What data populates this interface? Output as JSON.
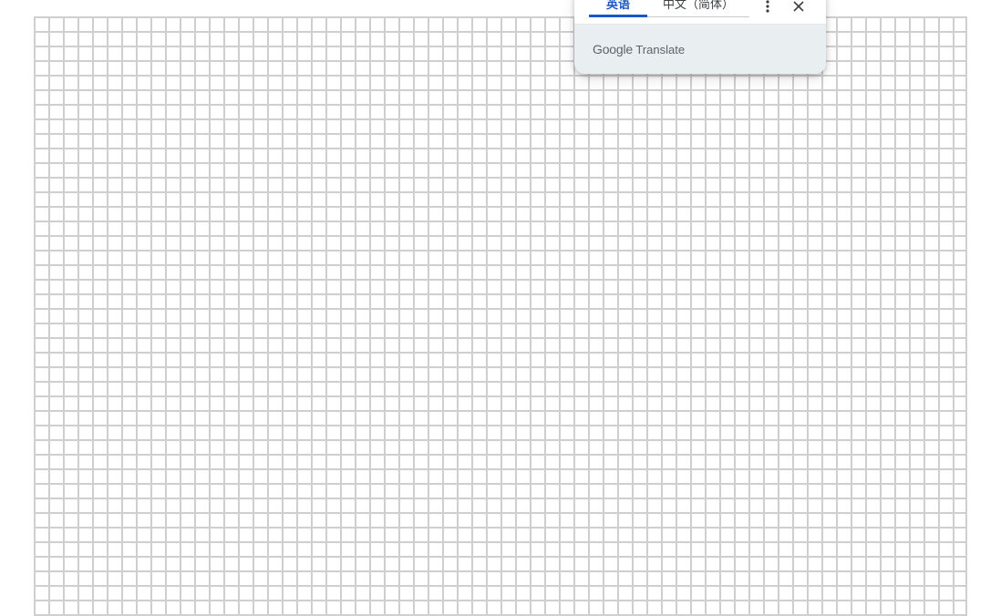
{
  "translate_popup": {
    "source_tab_label": "英语",
    "target_tab_label": "中文（简体）",
    "more_icon": "more-vert-icon",
    "close_icon": "close-icon",
    "brand_google": "Google",
    "brand_translate": "Translate"
  },
  "colors": {
    "accent": "#1a57c9",
    "grid_line": "#cfcfcf",
    "footer_bg": "#e9eef1"
  }
}
